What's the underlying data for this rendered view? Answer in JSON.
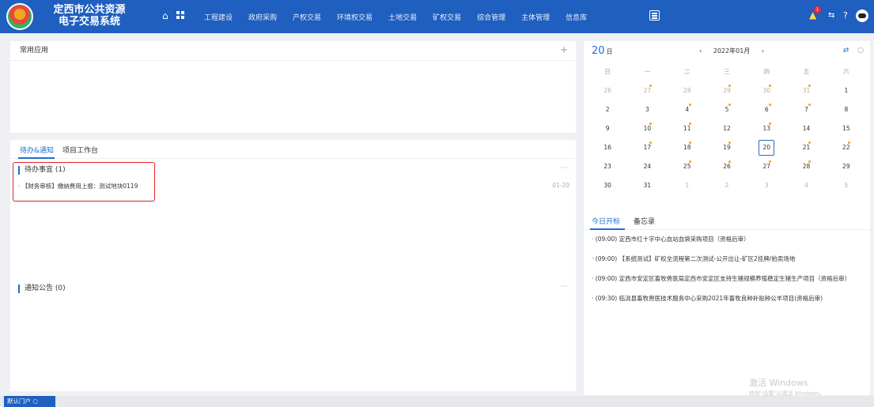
{
  "header": {
    "title_line1": "定西市公共资源",
    "title_line2": "电子交易系统",
    "nav": [
      "工程建设",
      "政府采购",
      "产权交易",
      "环境权交易",
      "土地交易",
      "矿权交易",
      "综合管理",
      "主体管理",
      "信息库"
    ],
    "notification_count": "1"
  },
  "apps": {
    "title": "常用应用",
    "add": "+"
  },
  "todo": {
    "tabs": [
      "待办&通知",
      "项目工作台"
    ],
    "pending_title": "待办事宜 (1)",
    "more": "···",
    "pending_items": [
      {
        "text": "· 【财务审核】缴纳费用上报：测试地块0119",
        "date": "01-20"
      }
    ],
    "notice_title": "通知公告 (0)",
    "notice_more": "···"
  },
  "calendar": {
    "day": "20",
    "day_unit": "日",
    "prev": "‹",
    "month_label": "2022年01月",
    "next": "›",
    "weekdays": [
      "日",
      "一",
      "二",
      "三",
      "四",
      "五",
      "六"
    ],
    "weeks": [
      [
        {
          "d": "26",
          "dim": true
        },
        {
          "d": "27",
          "dim": true,
          "dot": true
        },
        {
          "d": "28",
          "dim": true
        },
        {
          "d": "29",
          "dim": true,
          "dot": true
        },
        {
          "d": "30",
          "dim": true,
          "dot": true
        },
        {
          "d": "31",
          "dim": true,
          "dot": true
        },
        {
          "d": "1"
        }
      ],
      [
        {
          "d": "2"
        },
        {
          "d": "3"
        },
        {
          "d": "4",
          "dot": true
        },
        {
          "d": "5",
          "dot": true
        },
        {
          "d": "6",
          "dot": true
        },
        {
          "d": "7",
          "dot": true
        },
        {
          "d": "8"
        }
      ],
      [
        {
          "d": "9"
        },
        {
          "d": "10",
          "dot": true
        },
        {
          "d": "11",
          "dot": true
        },
        {
          "d": "12"
        },
        {
          "d": "13",
          "dot": true
        },
        {
          "d": "14"
        },
        {
          "d": "15"
        }
      ],
      [
        {
          "d": "16"
        },
        {
          "d": "17",
          "dot": true
        },
        {
          "d": "18",
          "dot": true
        },
        {
          "d": "19",
          "dot": true
        },
        {
          "d": "20",
          "today": true
        },
        {
          "d": "21",
          "dot": true
        },
        {
          "d": "22",
          "dot": true
        }
      ],
      [
        {
          "d": "23"
        },
        {
          "d": "24"
        },
        {
          "d": "25",
          "dot": true
        },
        {
          "d": "26",
          "dot": true
        },
        {
          "d": "27",
          "dot": true
        },
        {
          "d": "28",
          "dot": true
        },
        {
          "d": "29"
        }
      ],
      [
        {
          "d": "30"
        },
        {
          "d": "31"
        },
        {
          "d": "1",
          "dim": true
        },
        {
          "d": "2",
          "dim": true
        },
        {
          "d": "3",
          "dim": true
        },
        {
          "d": "4",
          "dim": true
        },
        {
          "d": "5",
          "dim": true
        }
      ]
    ]
  },
  "bids": {
    "tabs": [
      "今日开标",
      "备忘录"
    ],
    "items": [
      "· (09:00) 定西市红十字中心血站血袋采购项目（资格后审）",
      "· (09:00) 【系统测试】矿权全流程第二次测试-公开出让-矿区2挂牌/拍卖场地",
      "· (09:00) 定西市安定区畜牧兽医局定西市安定区支持生猪规模养殖稳定生猪生产项目（资格后审）",
      "· (09:30) 临洮县畜牧兽医技术服务中心采购2021年畜牧良种补贴种公羊项目(资格后审)"
    ]
  },
  "watermark": {
    "line1": "激活 Windows",
    "line2": "转到\"设置\"以激活 Windows。"
  },
  "footer": {
    "portal": "默认门户"
  },
  "colors": {
    "primary": "#1f5fbf",
    "accent": "#1f6fd1",
    "highlight": "#e02424",
    "dot": "#f4a21b"
  }
}
